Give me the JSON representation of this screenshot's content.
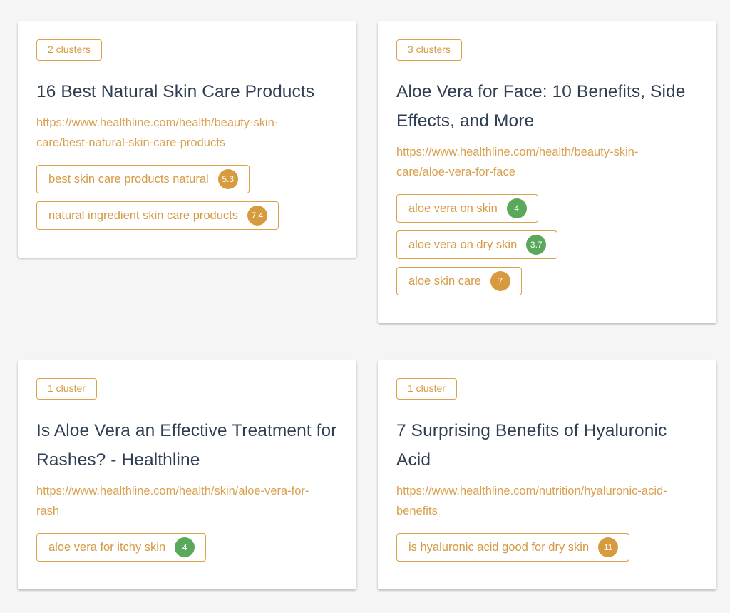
{
  "colors": {
    "accent": "#d9a14f",
    "title_text": "#2f3e52",
    "score_green": "#5aa85a",
    "score_orange": "#d89a3e",
    "background": "#f5f5f5",
    "card_background": "#ffffff"
  },
  "cards": [
    {
      "cluster_label": "2 clusters",
      "title": "16 Best Natural Skin Care Products",
      "url": "https://www.healthline.com/health/beauty-skin-care/best-natural-skin-care-products",
      "keywords": [
        {
          "label": "best skin care products natural",
          "score": "5.3",
          "score_level": "orange"
        },
        {
          "label": "natural ingredient skin care products",
          "score": "7.4",
          "score_level": "orange"
        }
      ]
    },
    {
      "cluster_label": "3 clusters",
      "title": "Aloe Vera for Face: 10 Benefits, Side Effects, and More",
      "url": "https://www.healthline.com/health/beauty-skin-care/aloe-vera-for-face",
      "keywords": [
        {
          "label": "aloe vera on skin",
          "score": "4",
          "score_level": "green"
        },
        {
          "label": "aloe vera on dry skin",
          "score": "3.7",
          "score_level": "green"
        },
        {
          "label": "aloe skin care",
          "score": "7",
          "score_level": "orange"
        }
      ]
    },
    {
      "cluster_label": "1 cluster",
      "title": "Is Aloe Vera an Effective Treatment for Rashes? - Healthline",
      "url": "https://www.healthline.com/health/skin/aloe-vera-for-rash",
      "keywords": [
        {
          "label": "aloe vera for itchy skin",
          "score": "4",
          "score_level": "green"
        }
      ]
    },
    {
      "cluster_label": "1 cluster",
      "title": "7 Surprising Benefits of Hyaluronic Acid",
      "url": "https://www.healthline.com/nutrition/hyaluronic-acid-benefits",
      "keywords": [
        {
          "label": "is hyaluronic acid good for dry skin",
          "score": "11",
          "score_level": "orange"
        }
      ]
    }
  ]
}
